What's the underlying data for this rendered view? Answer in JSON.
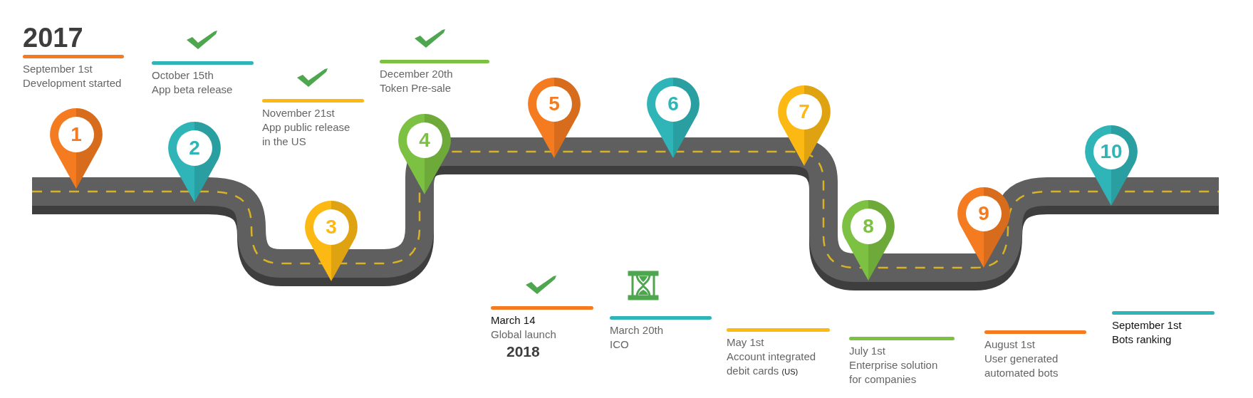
{
  "pins": [
    {
      "label": "1",
      "color": "#f47b20"
    },
    {
      "label": "2",
      "color": "#2fb5b7"
    },
    {
      "label": "3",
      "color": "#fdb913"
    },
    {
      "label": "4",
      "color": "#7dc142"
    },
    {
      "label": "5",
      "color": "#f47b20"
    },
    {
      "label": "6",
      "color": "#2fb5b7"
    },
    {
      "label": "7",
      "color": "#fdb913"
    },
    {
      "label": "8",
      "color": "#7dc142"
    },
    {
      "label": "9",
      "color": "#f47b20"
    },
    {
      "label": "10",
      "color": "#2fb5b7"
    }
  ],
  "milestones": [
    {
      "year": "2017",
      "date": "September 1st",
      "lines": [
        "Development started"
      ],
      "color": "#f47b20",
      "kind": "plain"
    },
    {
      "date": "October 15th",
      "lines": [
        "App beta release"
      ],
      "color": "#2fb5b7",
      "kind": "done"
    },
    {
      "date": "November 21st",
      "lines": [
        "App public release",
        "in the US"
      ],
      "color": "#fdb913",
      "kind": "done"
    },
    {
      "date": "December 20th",
      "lines": [
        "Token Pre-sale"
      ],
      "color": "#7dc142",
      "kind": "done"
    },
    {
      "date": "March 14",
      "lines": [
        "Global launch"
      ],
      "year": "2018",
      "color": "#f47b20",
      "kind": "done"
    },
    {
      "date": "March 20th",
      "lines": [
        "ICO"
      ],
      "color": "#2fb5b7",
      "kind": "pending"
    },
    {
      "date": "May 1st",
      "lines": [
        "Account integrated",
        "debit cards"
      ],
      "note": "(US)",
      "color": "#fdb913",
      "kind": "plain"
    },
    {
      "date": "July 1st",
      "lines": [
        "Enterprise solution",
        "for companies"
      ],
      "color": "#7dc142",
      "kind": "plain"
    },
    {
      "date": "August 1st",
      "lines": [
        "User generated",
        "automated bots"
      ],
      "color": "#f47b20",
      "kind": "plain"
    },
    {
      "date": "September 1st",
      "lines": [
        "Bots ranking"
      ],
      "color": "#2fb5b7",
      "kind": "plain"
    }
  ]
}
